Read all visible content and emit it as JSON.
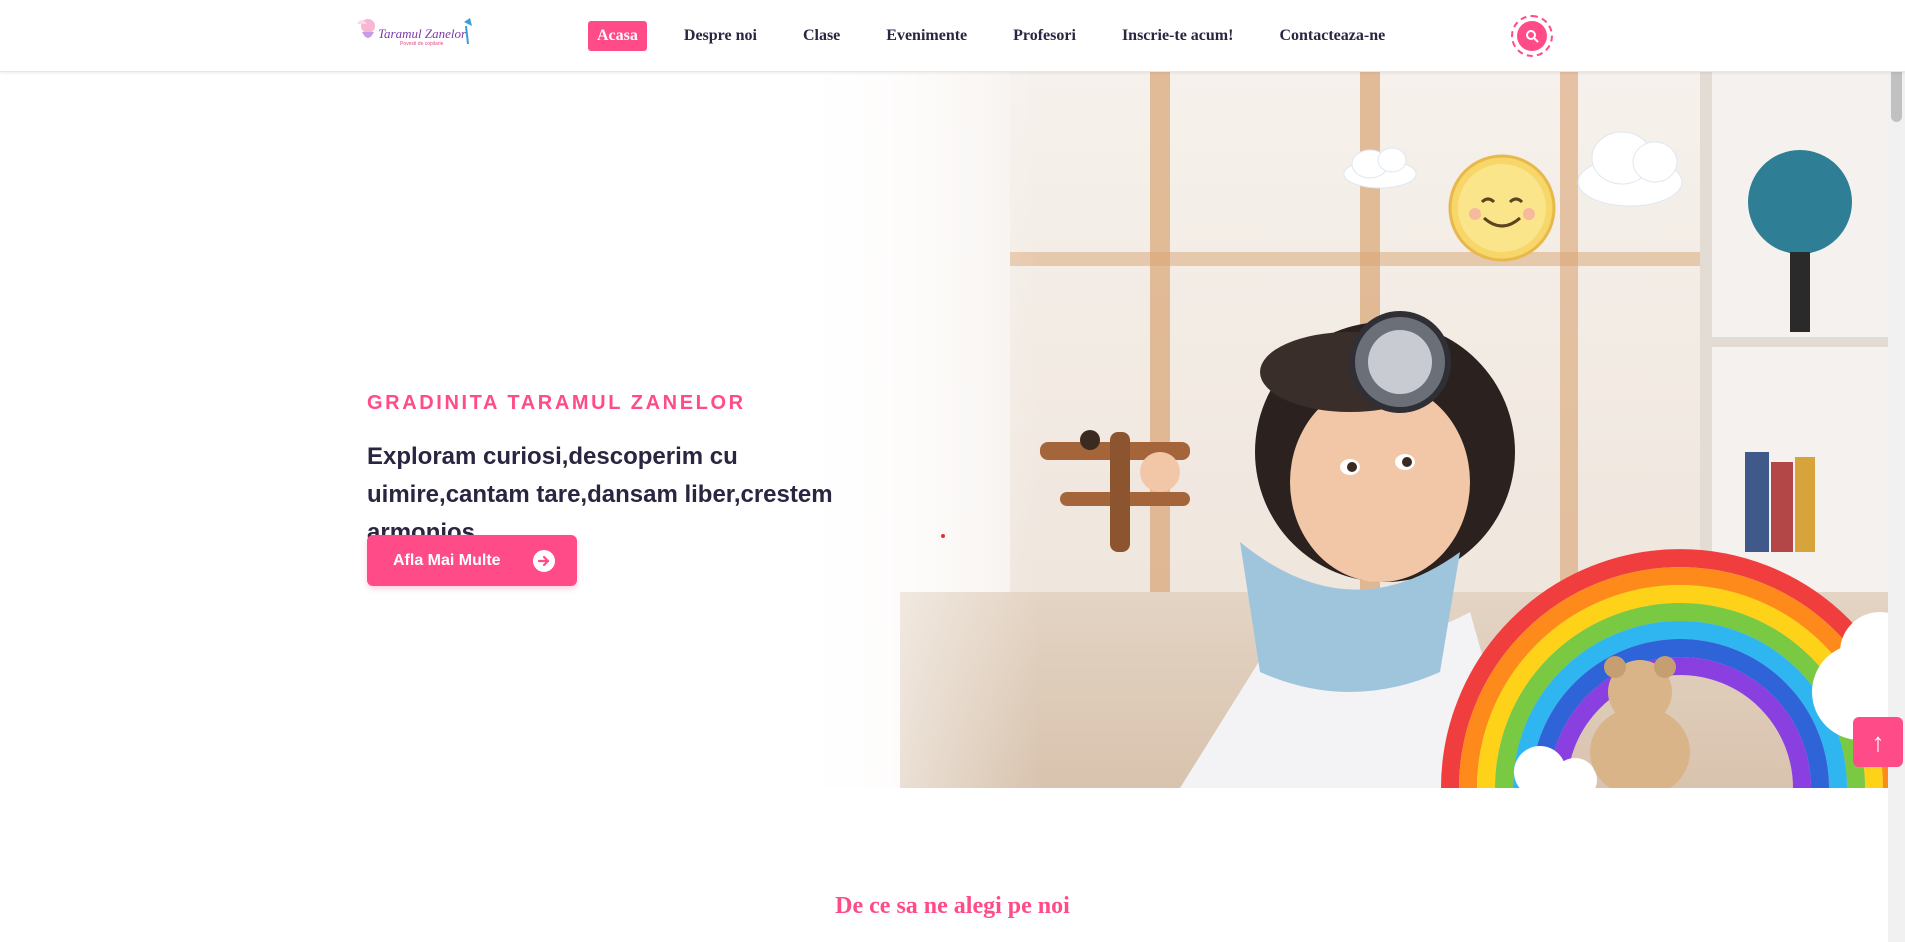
{
  "header": {
    "logo": {
      "line1": "Taramul Zanelor",
      "line2": "Povesti de copilarie"
    },
    "nav": [
      "Acasa",
      "Despre noi",
      "Clase",
      "Evenimente",
      "Profesori",
      "Inscrie-te acum!",
      "Contacteaza-ne"
    ],
    "active_nav": "Acasa"
  },
  "hero": {
    "subtitle": "GRADINITA TARAMUL ZANELOR",
    "title": "Exploram curiosi,descoperim cu uimire,cantam tare,dansam liber,crestem armonios",
    "button_label": "Afla Mai Multe"
  },
  "section": {
    "title": "De ce sa ne alegi pe noi"
  },
  "colors": {
    "accent": "#ff4b88",
    "heading": "#2a2540"
  },
  "icons": {
    "search": "search-icon",
    "arrow": "arrow-right-circle-icon",
    "scroll_top": "arrow-up-icon"
  }
}
